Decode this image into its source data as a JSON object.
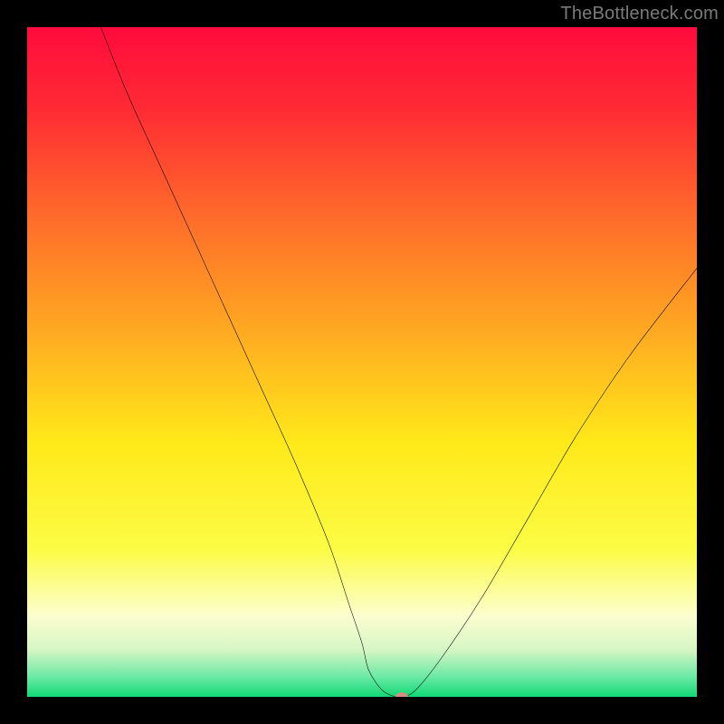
{
  "watermark": "TheBottleneck.com",
  "chart_data": {
    "type": "line",
    "title": "",
    "xlabel": "",
    "ylabel": "",
    "xlim": [
      0,
      100
    ],
    "ylim": [
      0,
      100
    ],
    "grid": false,
    "legend": false,
    "background_gradient": {
      "stops": [
        {
          "pos": 0.0,
          "color": "#ff0b3c"
        },
        {
          "pos": 0.12,
          "color": "#ff2a34"
        },
        {
          "pos": 0.28,
          "color": "#ff6a2b"
        },
        {
          "pos": 0.45,
          "color": "#ffa822"
        },
        {
          "pos": 0.62,
          "color": "#ffe91a"
        },
        {
          "pos": 0.78,
          "color": "#fcfc45"
        },
        {
          "pos": 0.88,
          "color": "#fcfed0"
        },
        {
          "pos": 0.93,
          "color": "#d6f6c4"
        },
        {
          "pos": 0.97,
          "color": "#6be9a4"
        },
        {
          "pos": 1.0,
          "color": "#12d977"
        }
      ]
    },
    "series": [
      {
        "name": "bottleneck-curve",
        "color": "#000000",
        "x": [
          11,
          15,
          20,
          25,
          30,
          35,
          40,
          45,
          48,
          50,
          51,
          53,
          55,
          56,
          58,
          62,
          68,
          75,
          82,
          90,
          100
        ],
        "y": [
          100,
          90,
          79,
          68,
          57,
          46,
          35,
          23,
          14,
          8,
          4,
          1,
          0,
          0,
          1,
          6,
          15,
          27,
          39,
          51,
          64
        ]
      }
    ],
    "marker": {
      "x": 56,
      "y": 0,
      "color": "#d58d82"
    }
  }
}
